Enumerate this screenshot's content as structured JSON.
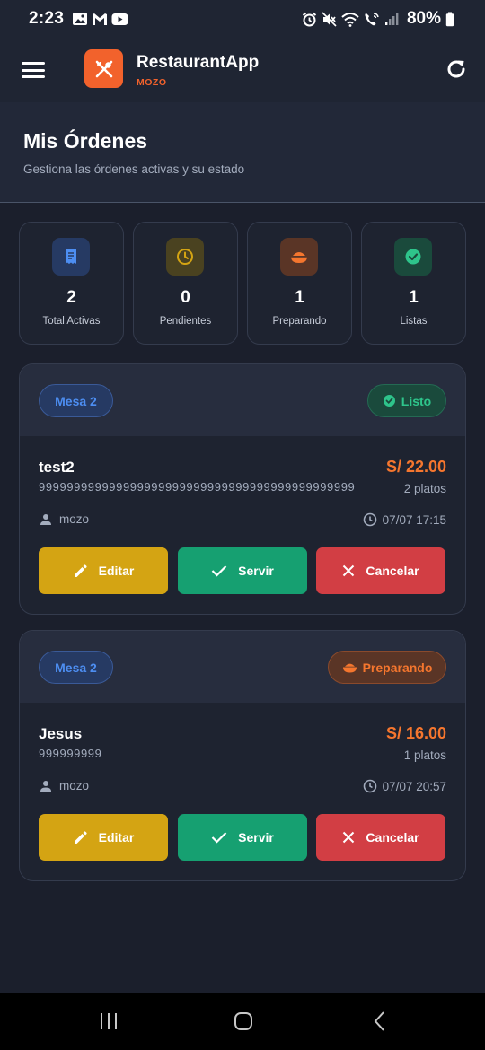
{
  "status_bar": {
    "time": "2:23",
    "battery": "80%"
  },
  "header": {
    "app_name": "RestaurantApp",
    "role": "MOZO"
  },
  "page": {
    "title": "Mis Órdenes",
    "subtitle": "Gestiona las órdenes activas y su estado"
  },
  "stats": [
    {
      "value": "2",
      "label": "Total Activas",
      "icon": "receipt-icon",
      "color": "#4d8ef2"
    },
    {
      "value": "0",
      "label": "Pendientes",
      "icon": "clock-icon",
      "color": "#d4a413"
    },
    {
      "value": "1",
      "label": "Preparando",
      "icon": "rice-bowl-icon",
      "color": "#f5762e"
    },
    {
      "value": "1",
      "label": "Listas",
      "icon": "check-circle-icon",
      "color": "#2ec48b"
    }
  ],
  "orders": [
    {
      "table": "Mesa 2",
      "status": "Listo",
      "customer": "test2",
      "phone": "999999999999999999999999999999999999999999999",
      "total": "S/ 22.00",
      "plates": "2 platos",
      "waiter": "mozo",
      "datetime": "07/07 17:15",
      "actions": {
        "edit": "Editar",
        "serve": "Servir",
        "cancel": "Cancelar"
      }
    },
    {
      "table": "Mesa 2",
      "status": "Preparando",
      "customer": "Jesus",
      "phone": "999999999",
      "total": "S/ 16.00",
      "plates": "1 platos",
      "waiter": "mozo",
      "datetime": "07/07 20:57",
      "actions": {
        "edit": "Editar",
        "serve": "Servir",
        "cancel": "Cancelar"
      }
    }
  ],
  "colors": {
    "accent": "#f2622c",
    "background": "#1b1f2c",
    "ready": "#2ec48b",
    "preparing": "#f5762e",
    "table_badge": "#4d8ef2"
  }
}
